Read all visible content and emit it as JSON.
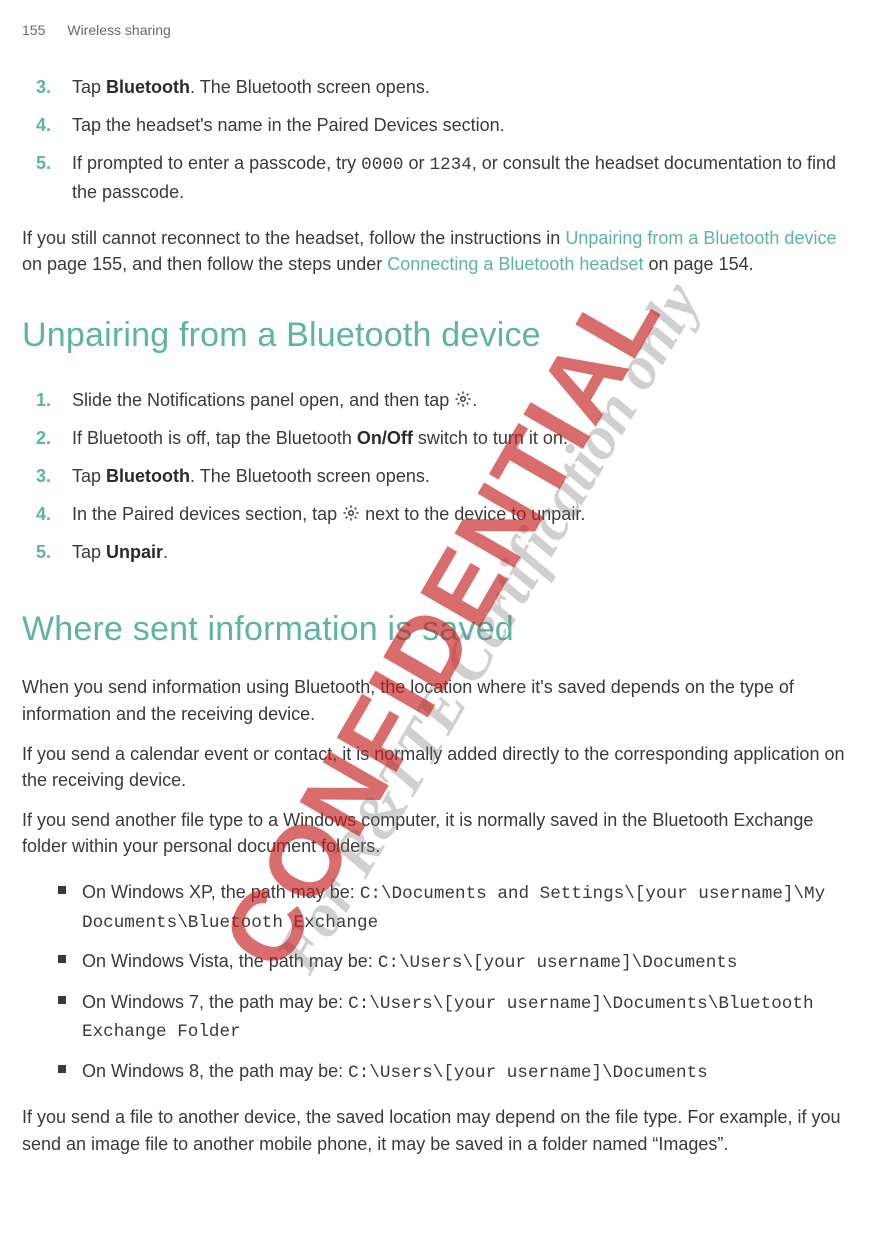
{
  "header": {
    "page_num": "155",
    "section": "Wireless sharing"
  },
  "watermarks": {
    "confidential": "CONFIDENTIAL",
    "cert": "For R&TTE Certification only"
  },
  "reconnect_steps": [
    {
      "n": "3.",
      "pre": "Tap ",
      "bold": "Bluetooth",
      "post": ". The Bluetooth screen opens."
    },
    {
      "n": "4.",
      "pre": "Tap the headset's name in the Paired Devices section.",
      "bold": "",
      "post": ""
    },
    {
      "n": "5.",
      "pre": "If prompted to enter a passcode, try ",
      "code1": "0000",
      "mid": " or ",
      "code2": "1234",
      "post": ", or consult the headset documentation to find the passcode."
    }
  ],
  "reconnect_fail": {
    "pre": "If you still cannot reconnect to the headset, follow the instructions in ",
    "link1": "Unpairing from a Bluetooth device",
    "mid1": " on page 155, and then follow the steps under ",
    "link2": "Connecting a Bluetooth headset",
    "post": " on page 154."
  },
  "unpair_heading": "Unpairing from a Bluetooth device",
  "unpair_steps": [
    {
      "n": "1.",
      "pre": "Slide the Notifications panel open, and then tap ",
      "icon": "gear",
      "post": "."
    },
    {
      "n": "2.",
      "pre": "If Bluetooth is off, tap the Bluetooth ",
      "bold": "On/Off",
      "post": " switch to turn it on."
    },
    {
      "n": "3.",
      "pre": "Tap ",
      "bold": "Bluetooth",
      "post": ". The Bluetooth screen opens."
    },
    {
      "n": "4.",
      "pre": "In the Paired devices section, tap ",
      "icon": "gear",
      "post": " next to the device to unpair."
    },
    {
      "n": "5.",
      "pre": "Tap ",
      "bold": "Unpair",
      "post": "."
    }
  ],
  "saved_heading": "Where sent information is saved",
  "saved_intro": "When you send information using Bluetooth, the location where it's saved depends on the type of information and the receiving device.",
  "saved_p2": "If you send a calendar event or contact, it is normally added directly to the corresponding application on the receiving device.",
  "saved_p3": "If you send another file type to a Windows computer, it is normally saved in the Bluetooth Exchange folder within your personal document folders.",
  "paths": [
    {
      "pre": "On Windows XP, the path may be: ",
      "code": "C:\\Documents and Settings\\[your username]\\My Documents\\Bluetooth Exchange"
    },
    {
      "pre": "On Windows Vista, the path may be: ",
      "code": "C:\\Users\\[your username]\\Documents"
    },
    {
      "pre": "On Windows 7, the path may be: ",
      "code": "C:\\Users\\[your username]\\Documents\\Bluetooth Exchange Folder"
    },
    {
      "pre": "On Windows 8, the path may be: ",
      "code": "C:\\Users\\[your username]\\Documents"
    }
  ],
  "saved_last": "If you send a file to another device, the saved location may depend on the file type. For example, if you send an image file to another mobile phone, it may be saved in a folder named “Images”."
}
